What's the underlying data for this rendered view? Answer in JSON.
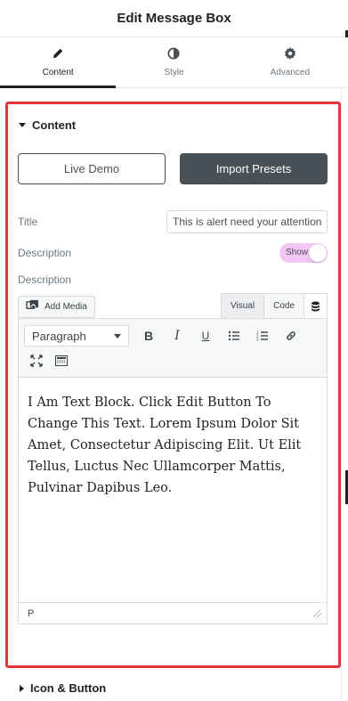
{
  "header": {
    "title": "Edit Message Box"
  },
  "tabs": [
    {
      "label": "Content",
      "icon": "pencil-icon",
      "active": true
    },
    {
      "label": "Style",
      "icon": "half-circle-icon",
      "active": false
    },
    {
      "label": "Advanced",
      "icon": "gear-icon",
      "active": false
    }
  ],
  "section": {
    "title": "Content",
    "buttons": {
      "live_demo": "Live Demo",
      "import_presets": "Import Presets"
    },
    "title_control": {
      "label": "Title",
      "value": "This is alert need your attention"
    },
    "description_toggle": {
      "label": "Description",
      "state_text": "Show",
      "on": true
    },
    "description_editor": {
      "label": "Description",
      "add_media": "Add Media",
      "modes": {
        "visual": "Visual",
        "code": "Code"
      },
      "active_mode": "Visual",
      "format_select": "Paragraph",
      "toolbar_row1": [
        "bold-icon",
        "italic-icon",
        "underline-icon",
        "bullet-list-icon",
        "numbered-list-icon",
        "link-icon"
      ],
      "toolbar_row2": [
        "fullscreen-icon",
        "toolbar-toggle-icon"
      ],
      "content": "I Am Text Block. Click Edit Button To Change This Text. Lorem Ipsum Dolor Sit Amet, Consectetur Adipiscing Elit. Ut Elit Tellus, Luctus Nec Ullamcorper Mattis, Pulvinar Dapibus Leo.",
      "status_path": "P"
    }
  },
  "next_section": {
    "title": "Icon & Button"
  },
  "colors": {
    "highlight_border": "#e2363f",
    "dark_button": "#495157",
    "toggle_bg": "#f3c6f4",
    "text": "#495157"
  }
}
